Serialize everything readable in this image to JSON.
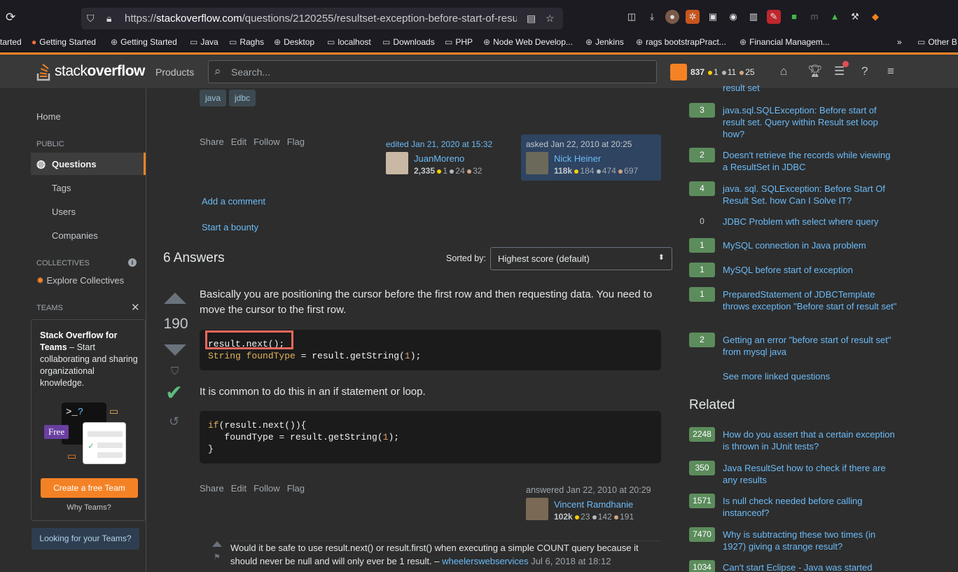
{
  "browser": {
    "url_prefix": "https://",
    "url_domain": "stackoverflow.com",
    "url_path": "/questions/2120255/resultset-exception-before-start-of-resu",
    "bookmarks": [
      "tarted",
      "Getting Started",
      "Getting Started",
      "Java",
      "Raghs",
      "Desktop",
      "localhost",
      "Downloads",
      "PHP",
      "Node Web Develop...",
      "Jenkins",
      "rags bootstrapPract...",
      "Financial Managem...",
      "Other B"
    ]
  },
  "header": {
    "logo_stack": "stack",
    "logo_overflow": "overflow",
    "products": "Products",
    "search_placeholder": "Search...",
    "rep": "837",
    "gold": "1",
    "silver": "11",
    "bronze": "25"
  },
  "nav": {
    "home": "Home",
    "public": "PUBLIC",
    "questions": "Questions",
    "tags": "Tags",
    "users": "Users",
    "companies": "Companies",
    "collectives": "COLLECTIVES",
    "explore": "Explore Collectives",
    "teams": "TEAMS",
    "teams_title": "Stack Overflow for Teams",
    "teams_desc": " – Start collaborating and sharing organizational knowledge.",
    "free": "Free",
    "create": "Create a free Team",
    "why": "Why Teams?",
    "looking": "Looking for your Teams?"
  },
  "question": {
    "tags": [
      "java",
      "jdbc"
    ],
    "actions": [
      "Share",
      "Edit",
      "Follow",
      "Flag"
    ],
    "edited": "edited Jan 21, 2020 at 15:32",
    "editor": "JuanMoreno",
    "editor_rep": "2,335",
    "editor_gold": "1",
    "editor_silver": "24",
    "editor_bronze": "32",
    "asked": "asked Jan 22, 2010 at 20:25",
    "asker": "Nick Heiner",
    "asker_rep": "118k",
    "asker_gold": "184",
    "asker_silver": "474",
    "asker_bronze": "697",
    "add_comment": "Add a comment",
    "bounty": "Start a bounty"
  },
  "answers": {
    "heading": "6 Answers",
    "sorted_by": "Sorted by:",
    "sort_value": "Highest score (default)",
    "votes": "190",
    "text1": "Basically you are positioning the cursor before the first row and then requesting data. You need to move the cursor to the first row.",
    "code1_line1": "result.next();",
    "code1_line2_type": "String",
    "code1_line2_var": "foundType",
    "code1_line2_rest": " = result.getString(",
    "code1_num": "1",
    "code1_end": ");",
    "text2": "It is common to do this in an if statement or loop.",
    "code2_kw": "if",
    "code2_a": "(result.next()){",
    "code2_b": "   foundType = result.getString(",
    "code2_num": "1",
    "code2_c": ");",
    "code2_d": "}",
    "actions": [
      "Share",
      "Edit",
      "Follow",
      "Flag"
    ],
    "answered": "answered Jan 22, 2010 at 20:29",
    "answerer": "Vincent Ramdhanie",
    "answerer_rep": "102k",
    "answerer_gold": "23",
    "answerer_silver": "142",
    "answerer_bronze": "191",
    "comment_text": "Would it be safe to use result.next() or result.first() when executing a simple COUNT query because it should never be null and will only ever be 1 result. – ",
    "comment_user": "wheelerswebservices",
    "comment_date": " Jul 6, 2018 at 18:12"
  },
  "linked": {
    "partial_top": "result set",
    "items": [
      {
        "count": "3",
        "title": "java.sql.SQLException: Before start of result set. Query within Result set loop how?"
      },
      {
        "count": "2",
        "title": "Doesn't retrieve the records while viewing a ResultSet in JDBC"
      },
      {
        "count": "4",
        "title": "java. sql. SQLException: Before Start Of Result Set. how Can I Solve IT?"
      },
      {
        "count": "0",
        "title": "JDBC Problem wth select where query"
      },
      {
        "count": "1",
        "title": "MySQL connection in Java problem"
      },
      {
        "count": "1",
        "title": "MySQL before start of exception"
      },
      {
        "count": "1",
        "title": "PreparedStatement of JDBCTemplate throws exception \"Before start of result set\""
      },
      {
        "count": "2",
        "title": "Getting an error \"before start of result set\" from mysql java"
      }
    ],
    "see_more": "See more linked questions"
  },
  "related": {
    "heading": "Related",
    "items": [
      {
        "count": "2248",
        "title": "How do you assert that a certain exception is thrown in JUnit tests?"
      },
      {
        "count": "350",
        "title": "Java ResultSet how to check if there are any results"
      },
      {
        "count": "1571",
        "title": "Is null check needed before calling instanceof?"
      },
      {
        "count": "7470",
        "title": "Why is subtracting these two times (in 1927) giving a strange result?"
      },
      {
        "count": "1034",
        "title": "Can't start Eclipse - Java was started"
      }
    ]
  }
}
